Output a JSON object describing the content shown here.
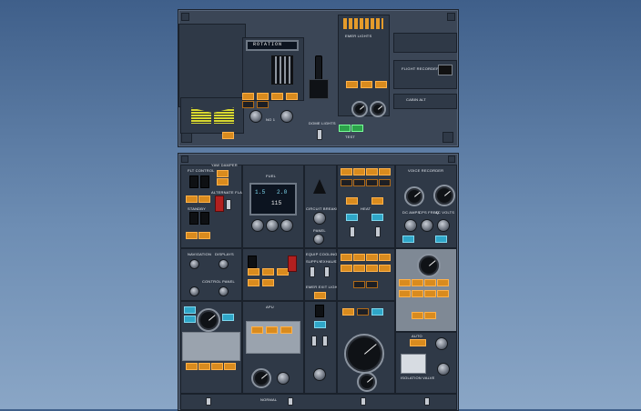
{
  "upper_panel": {
    "labels": {
      "emergency_lights": "EMER LIGHTS",
      "flight_recorder": "FLIGHT RECORDER",
      "cabin_altitude": "CABIN ALT",
      "no_1": "NO 1",
      "dome_lights": "DOME LIGHTS",
      "test": "TEST"
    },
    "display_text": "ROTATION"
  },
  "lower_panel": {
    "labels": {
      "flt_control": "FLT CONTROL",
      "standby": "STANDBY",
      "alternate_flaps": "ALTERNATE FLAPS",
      "yaw_damper": "YAW DAMPER",
      "navigation": "NAVIGATION",
      "displays": "DISPLAYS",
      "control_panel": "CONTROL PANEL",
      "circuit_breaker": "CIRCUIT BREAKER",
      "panel": "PANEL",
      "equip_cooling": "EQUIP COOLING",
      "supply": "SUPPLY",
      "exhaust": "EXHAUST",
      "emer_exit_lights": "EMER EXIT LIGHTS",
      "voice_recorder": "VOICE RECORDER",
      "dc_amps": "DC AMPS",
      "cps_freq": "CPS FREQ",
      "ac_volts": "AC VOLTS",
      "fuel": "FUEL",
      "heat": "HEAT",
      "auto": "AUTO",
      "normal": "NORMAL",
      "isolation_valve": "ISOLATION VALVE",
      "apu": "APU"
    },
    "fuel_display": {
      "left": "1.5",
      "right": "2.0",
      "center": "115"
    },
    "colors": {
      "amber": "#d98b1e",
      "blue": "#2fa6c8",
      "green": "#2ca24a",
      "red": "#b2201f",
      "panel": "#3b4656"
    }
  }
}
